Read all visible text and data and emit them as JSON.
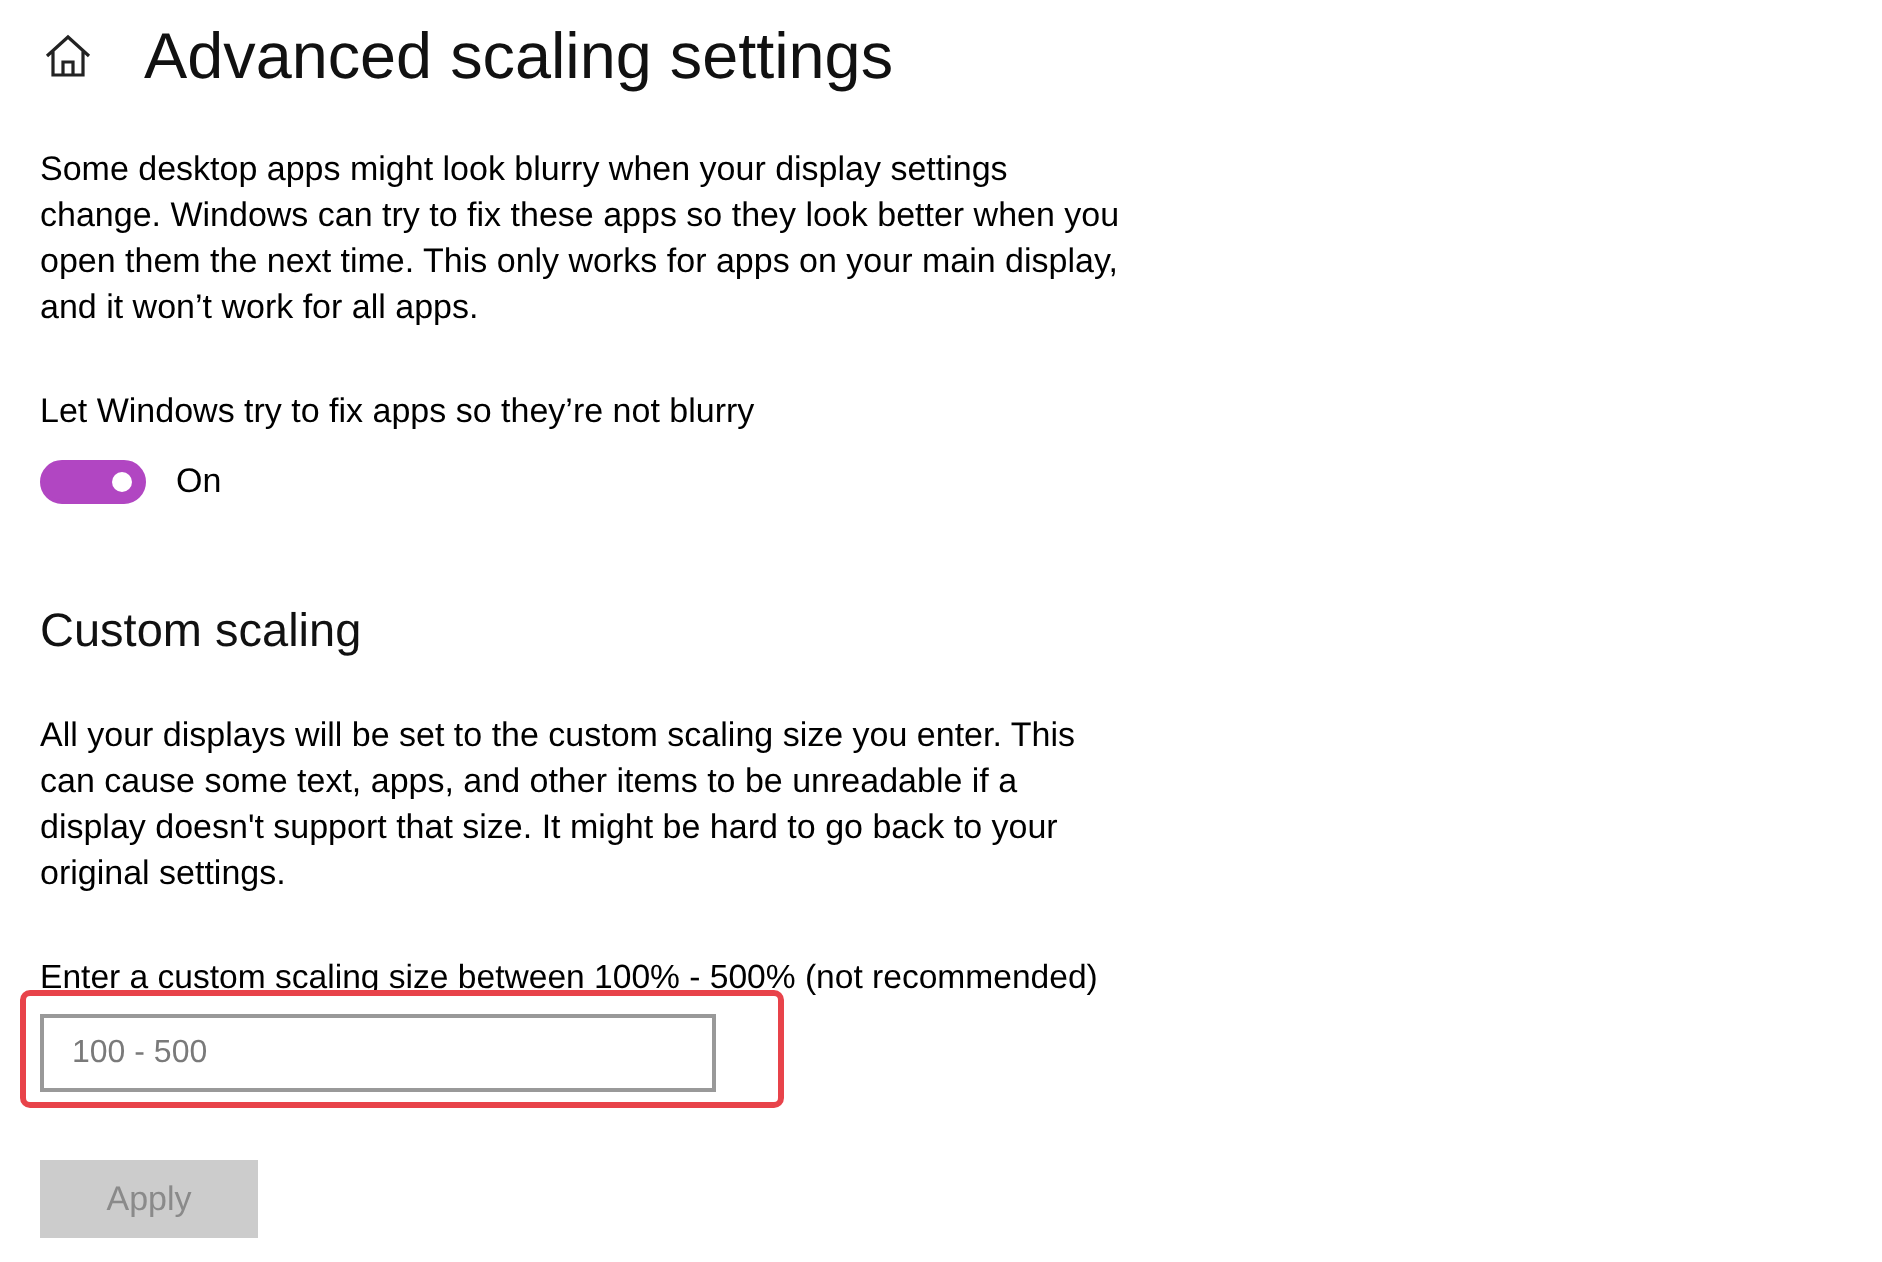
{
  "page": {
    "title": "Advanced scaling settings"
  },
  "blurry_fix": {
    "description": "Some desktop apps might look blurry when your display settings change. Windows can try to fix these apps so they look better when you open them the next time. This only works for apps on your main display, and it won’t work for all apps.",
    "toggle": {
      "label": "Let Windows try to fix apps so they’re not blurry",
      "on": true,
      "state_text": "On"
    }
  },
  "custom_scaling": {
    "heading": "Custom scaling",
    "description": "All your displays will be set to the custom scaling size you enter. This can cause some text, apps, and other items to be unreadable if a display doesn't support that size. It might be hard to go back to your original settings.",
    "field": {
      "label": "Enter a custom scaling size between 100% - 500% (not recommended)",
      "placeholder": "100 - 500",
      "highlighted": true
    },
    "apply_button": {
      "label": "Apply",
      "disabled": true
    }
  }
}
